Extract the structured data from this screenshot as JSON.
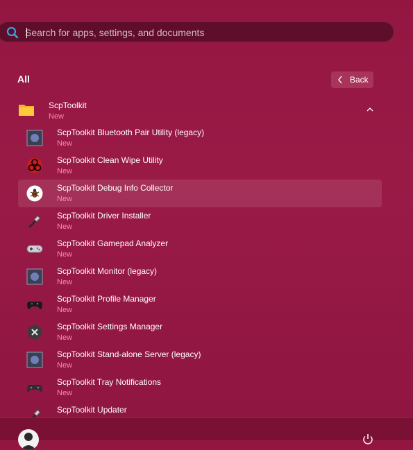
{
  "search": {
    "placeholder": "Search for apps, settings, and documents",
    "value": ""
  },
  "list": {
    "heading": "All",
    "back_label": "Back"
  },
  "group": {
    "name": "ScpToolkit",
    "badge": "New",
    "icon": "folder-icon"
  },
  "apps": [
    {
      "name": "ScpToolkit Bluetooth Pair Utility (legacy)",
      "badge": "New",
      "icon": "legacy-app-icon"
    },
    {
      "name": "ScpToolkit Clean Wipe Utility",
      "badge": "New",
      "icon": "biohazard-icon"
    },
    {
      "name": "ScpToolkit Debug Info Collector",
      "badge": "New",
      "icon": "bug-icon"
    },
    {
      "name": "ScpToolkit Driver Installer",
      "badge": "New",
      "icon": "usb-plug-icon"
    },
    {
      "name": "ScpToolkit Gamepad Analyzer",
      "badge": "New",
      "icon": "snes-controller-icon"
    },
    {
      "name": "ScpToolkit Monitor (legacy)",
      "badge": "New",
      "icon": "legacy-app-icon"
    },
    {
      "name": "ScpToolkit Profile Manager",
      "badge": "New",
      "icon": "xbox-controller-icon"
    },
    {
      "name": "ScpToolkit Settings Manager",
      "badge": "New",
      "icon": "settings-tools-icon"
    },
    {
      "name": "ScpToolkit Stand-alone Server (legacy)",
      "badge": "New",
      "icon": "legacy-app-icon"
    },
    {
      "name": "ScpToolkit Tray Notifications",
      "badge": "New",
      "icon": "ps-controller-icon"
    },
    {
      "name": "ScpToolkit Updater",
      "badge": "",
      "icon": "usb-plug-icon"
    }
  ],
  "footer": {
    "user_name": "",
    "power_icon": "power-icon"
  },
  "colors": {
    "background": "#931641",
    "badge": "#ff86b5",
    "search_bg": "#5e0d2a",
    "accent": "#1aa3e8"
  }
}
